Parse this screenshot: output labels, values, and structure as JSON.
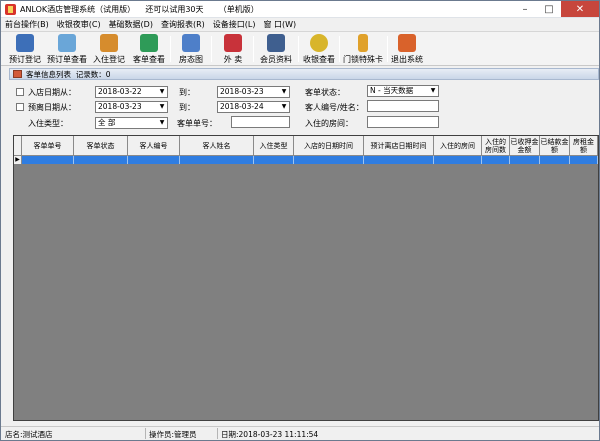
{
  "window": {
    "title": "ANLOK酒店管理系统（试用版）    还可以试用30天      （单机版）"
  },
  "menu": [
    "前台操作(B)",
    "收银夜审(C)",
    "基础数据(D)",
    "查询报表(R)",
    "设备接口(L)",
    "窗 口(W)"
  ],
  "toolbar": [
    {
      "label": "预订登记",
      "icon": "person-reservation-icon",
      "color": "#3d6fb8"
    },
    {
      "label": "预订单查看",
      "icon": "reservation-list-icon",
      "color": "#6aa6d8"
    },
    {
      "label": "入住登记",
      "icon": "person-checkin-icon",
      "color": "#d68c2d"
    },
    {
      "label": "客单查看",
      "icon": "guest-card-icon",
      "color": "#2e9b58"
    },
    {
      "label": "房态图",
      "icon": "room-status-icon",
      "color": "#4e7fc9"
    },
    {
      "label": "外 卖",
      "icon": "shopping-cart-icon",
      "color": "#c8323a"
    },
    {
      "label": "会员资料",
      "icon": "member-card-icon",
      "color": "#3f5f8f"
    },
    {
      "label": "收银查看",
      "icon": "coins-icon",
      "color": "#d8b52b"
    },
    {
      "label": "门锁特殊卡",
      "icon": "key-icon",
      "color": "#e0a12a"
    },
    {
      "label": "退出系统",
      "icon": "exit-icon",
      "color": "#d9622b"
    }
  ],
  "panel": {
    "title": "客单信息列表  记录数：0"
  },
  "filters": {
    "checkin_date_from_label": "入店日期从：",
    "checkin_from": "2018-03-22",
    "to_label": "到：",
    "checkin_to": "2018-03-23",
    "checkout_date_from_label": "预离日期从：",
    "checkout_from": "2018-03-23",
    "checkout_to": "2018-03-24",
    "checkin_type_label": "入住类型：",
    "checkin_type": "全 部",
    "guest_order_no_label": "客单单号：",
    "guest_status_label": "客单状态：",
    "guest_status": "N - 当天数据",
    "guest_id_name_label": "客人编号/姓名：",
    "room_label": "入住的房间："
  },
  "grid": {
    "columns": [
      "客单单号",
      "客单状态",
      "客人编号",
      "客人姓名",
      "入住类型",
      "入店的日期时间",
      "预计离店日期时间",
      "入住的房间",
      "入住的房间数",
      "已收押金金额",
      "已结款金额",
      "房租金额"
    ],
    "row_indicator": "▶"
  },
  "status": {
    "hotel": "店名:测试酒店",
    "operator": "操作员:管理员",
    "date": "日期:2018-03-23 11:11:54"
  }
}
